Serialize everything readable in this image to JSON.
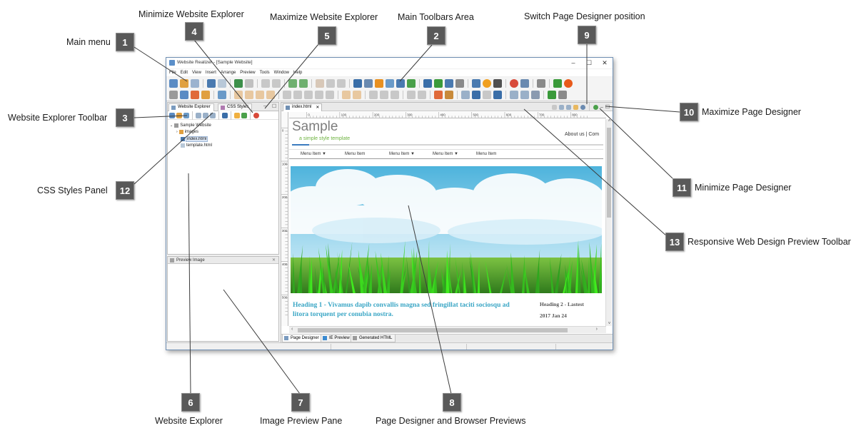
{
  "callouts": {
    "c1": {
      "num": "1",
      "label": "Main menu"
    },
    "c2": {
      "num": "2",
      "label": "Main Toolbars Area"
    },
    "c3": {
      "num": "3",
      "label": "Website Explorer Toolbar"
    },
    "c4": {
      "num": "4",
      "label": "Minimize Website Explorer"
    },
    "c5": {
      "num": "5",
      "label": "Maximize Website Explorer"
    },
    "c6": {
      "num": "6",
      "label": "Website Explorer"
    },
    "c7": {
      "num": "7",
      "label": "Image Preview Pane"
    },
    "c8": {
      "num": "8",
      "label": "Page Designer and Browser Previews"
    },
    "c9": {
      "num": "9",
      "label": "Switch Page Designer position"
    },
    "c10": {
      "num": "10",
      "label": "Maximize Page Designer"
    },
    "c11": {
      "num": "11",
      "label": "Minimize Page Designer"
    },
    "c12": {
      "num": "12",
      "label": "CSS Styles Panel"
    },
    "c13": {
      "num": "13",
      "label": "Responsive Web Design Preview Toolbar"
    }
  },
  "window": {
    "title": "Website Realizer - [Sample Website]",
    "minimize": "–",
    "maximize": "☐",
    "close": "✕"
  },
  "menu": [
    "File",
    "Edit",
    "View",
    "Insert",
    "Arrange",
    "Preview",
    "Tools",
    "Window",
    "Help"
  ],
  "left_panel": {
    "tab_explorer": "Website Explorer",
    "tab_css": "CSS Styles",
    "minimize": "–",
    "maximize": "☐",
    "tree": {
      "root": "Sample Website",
      "folder": "images",
      "file1": "index.html",
      "file2": "template.html"
    }
  },
  "preview_panel": {
    "title": "Preview Image",
    "close": "✕"
  },
  "designer": {
    "doc_tab": "index.html",
    "doc_tab_close": "✕",
    "ruler_h": [
      "0",
      "100",
      "200",
      "300",
      "400",
      "500",
      "600",
      "700",
      "800"
    ],
    "ruler_v": [
      "0",
      "100",
      "200",
      "300",
      "400",
      "500"
    ],
    "page": {
      "site_title": "Sample",
      "site_tagline": "a simple style template",
      "top_links": "About us | Com",
      "nav": [
        "Menu Item ▼",
        "Menu Item",
        "Menu Item ▼",
        "Menu Item ▼",
        "Menu Item"
      ],
      "heading1": "Heading 1 - Vivamus dapib convallis magna sed fringillat taciti sociosqu ad litora torquent per conubia nostra.",
      "heading2": "Heading 2 - Lastest",
      "heading2_date": "2017 Jan 24"
    },
    "bottom_tabs": [
      "Page Designer",
      "IE Preview",
      "Generated HTML"
    ]
  },
  "colors": {
    "callout_badge": "#595959",
    "accent_blue": "#3b7bbf",
    "tagline_green": "#6db33f",
    "heading_teal": "#3aa6c5"
  }
}
